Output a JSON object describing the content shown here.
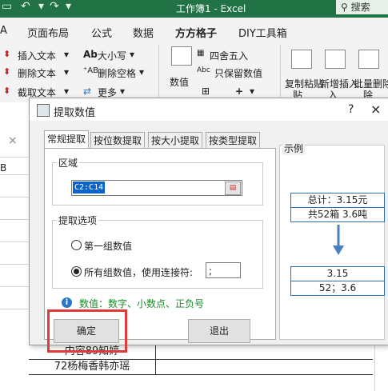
{
  "titlebar": {
    "title": "工作簿1 - Excel",
    "search": "搜索"
  },
  "menu": {
    "items": [
      "A",
      "页面布局",
      "公式",
      "数据",
      "方方格子",
      "DIY工具箱"
    ]
  },
  "ribbon": {
    "insert_text": "插入文本",
    "delete_text": "删除文本",
    "truncate_text": "截取文本",
    "case": "大小写",
    "delete_space": "删除空格",
    "more": "更多",
    "numeric": "数值",
    "rounding": "四舍五入",
    "keep_formula": "只保留数值",
    "copy_paste": "复制粘贴",
    "add_insert": "新增插入",
    "batch_delete": "批量删除",
    "paste_sub": "贴",
    "insert_sub": "入",
    "delete_sub": "除"
  },
  "sheet": {
    "col_b": "B",
    "row1": "内容89知婷",
    "row2": "72杨梅香韩亦瑶",
    "close_x": "×"
  },
  "dialog": {
    "title": "提取数值",
    "help": "?",
    "close": "×",
    "tabs": [
      "常规提取",
      "按位数提取",
      "按大小提取",
      "按类型提取"
    ],
    "range_label": "区域",
    "range_value": "C2:C14",
    "options_label": "提取选项",
    "option_first": "第一组数值",
    "option_all": "所有组数值，使用连接符:",
    "separator": ";",
    "info": "数值：数字、小数点、正负号",
    "ok": "确定",
    "cancel": "退出",
    "example_label": "示例",
    "example_input": [
      "总计：3.15元",
      "共52箱 3.6吨"
    ],
    "example_output": [
      "3.15",
      "52；3.6"
    ]
  },
  "colors": {
    "excel_green": "#217346",
    "highlight_red": "#e03a3a",
    "example_blue": "#2d6fb5"
  }
}
